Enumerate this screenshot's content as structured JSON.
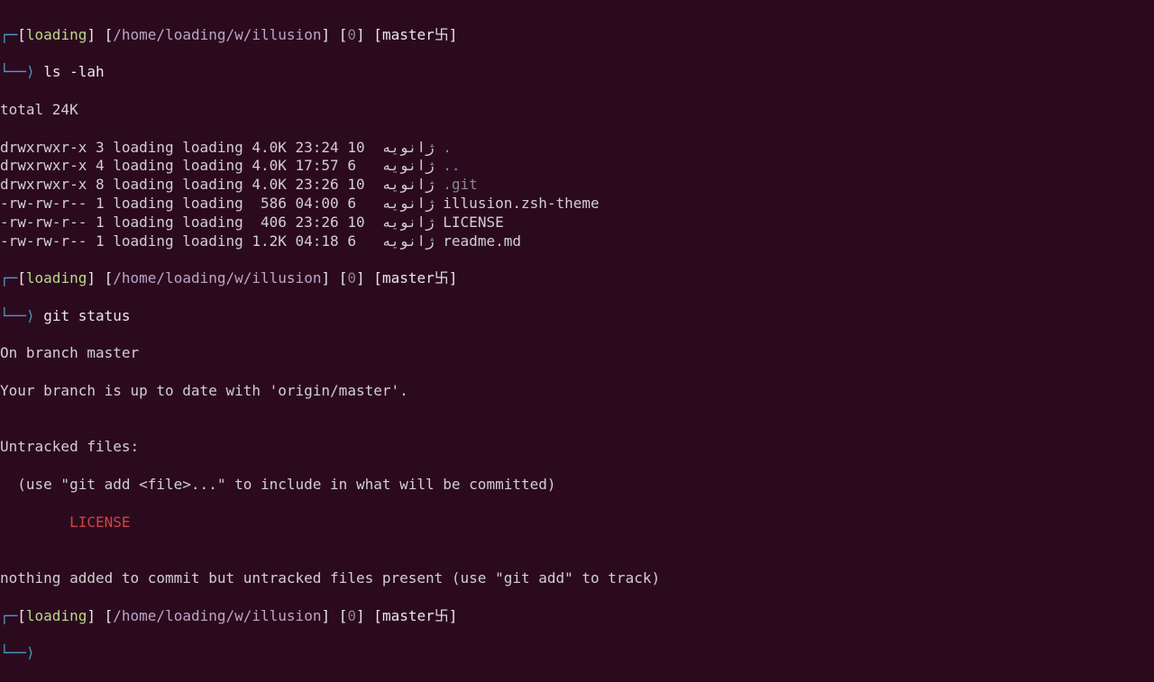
{
  "prompt": {
    "username": "loading",
    "path": "/home/loading/w/illusion",
    "retcode": "0",
    "branch": "master",
    "glyph": "卐",
    "corner_tl": "┌─",
    "corner_bl": "└──",
    "arrow": "⟩"
  },
  "commands": {
    "ls": "ls -lah",
    "gitstatus": "git status"
  },
  "ls_output": {
    "total": "total 24K",
    "rows": [
      {
        "perm": "drwxrwxr-x",
        "links": "3",
        "owner": "loading",
        "group": "loading",
        "size": "4.0K",
        "time": "23:24",
        "day": "10",
        "month": "ژانویه",
        "name": ".",
        "style": "dir-link"
      },
      {
        "perm": "drwxrwxr-x",
        "links": "4",
        "owner": "loading",
        "group": "loading",
        "size": "4.0K",
        "time": "17:57",
        "day": "6 ",
        "month": "ژانویه",
        "name": "..",
        "style": "dir-link"
      },
      {
        "perm": "drwxrwxr-x",
        "links": "8",
        "owner": "loading",
        "group": "loading",
        "size": "4.0K",
        "time": "23:26",
        "day": "10",
        "month": "ژانویه",
        "name": ".git",
        "style": "git-dir"
      },
      {
        "perm": "-rw-rw-r--",
        "links": "1",
        "owner": "loading",
        "group": "loading",
        "size": " 586",
        "time": "04:00",
        "day": "6 ",
        "month": "ژانویه",
        "name": "illusion.zsh-theme",
        "style": "output"
      },
      {
        "perm": "-rw-rw-r--",
        "links": "1",
        "owner": "loading",
        "group": "loading",
        "size": " 406",
        "time": "23:26",
        "day": "10",
        "month": "ژانویه",
        "name": "LICENSE",
        "style": "output"
      },
      {
        "perm": "-rw-rw-r--",
        "links": "1",
        "owner": "loading",
        "group": "loading",
        "size": "1.2K",
        "time": "04:18",
        "day": "6 ",
        "month": "ژانویه",
        "name": "readme.md",
        "style": "output"
      }
    ]
  },
  "git_output": {
    "l1": "On branch master",
    "l2": "Your branch is up to date with 'origin/master'.",
    "l3": "",
    "l4": "Untracked files:",
    "l5": "  (use \"git add <file>...\" to include in what will be committed)",
    "l6_indent": "        ",
    "l6_file": "LICENSE",
    "l7": "",
    "l8": "nothing added to commit but untracked files present (use \"git add\" to track)"
  }
}
